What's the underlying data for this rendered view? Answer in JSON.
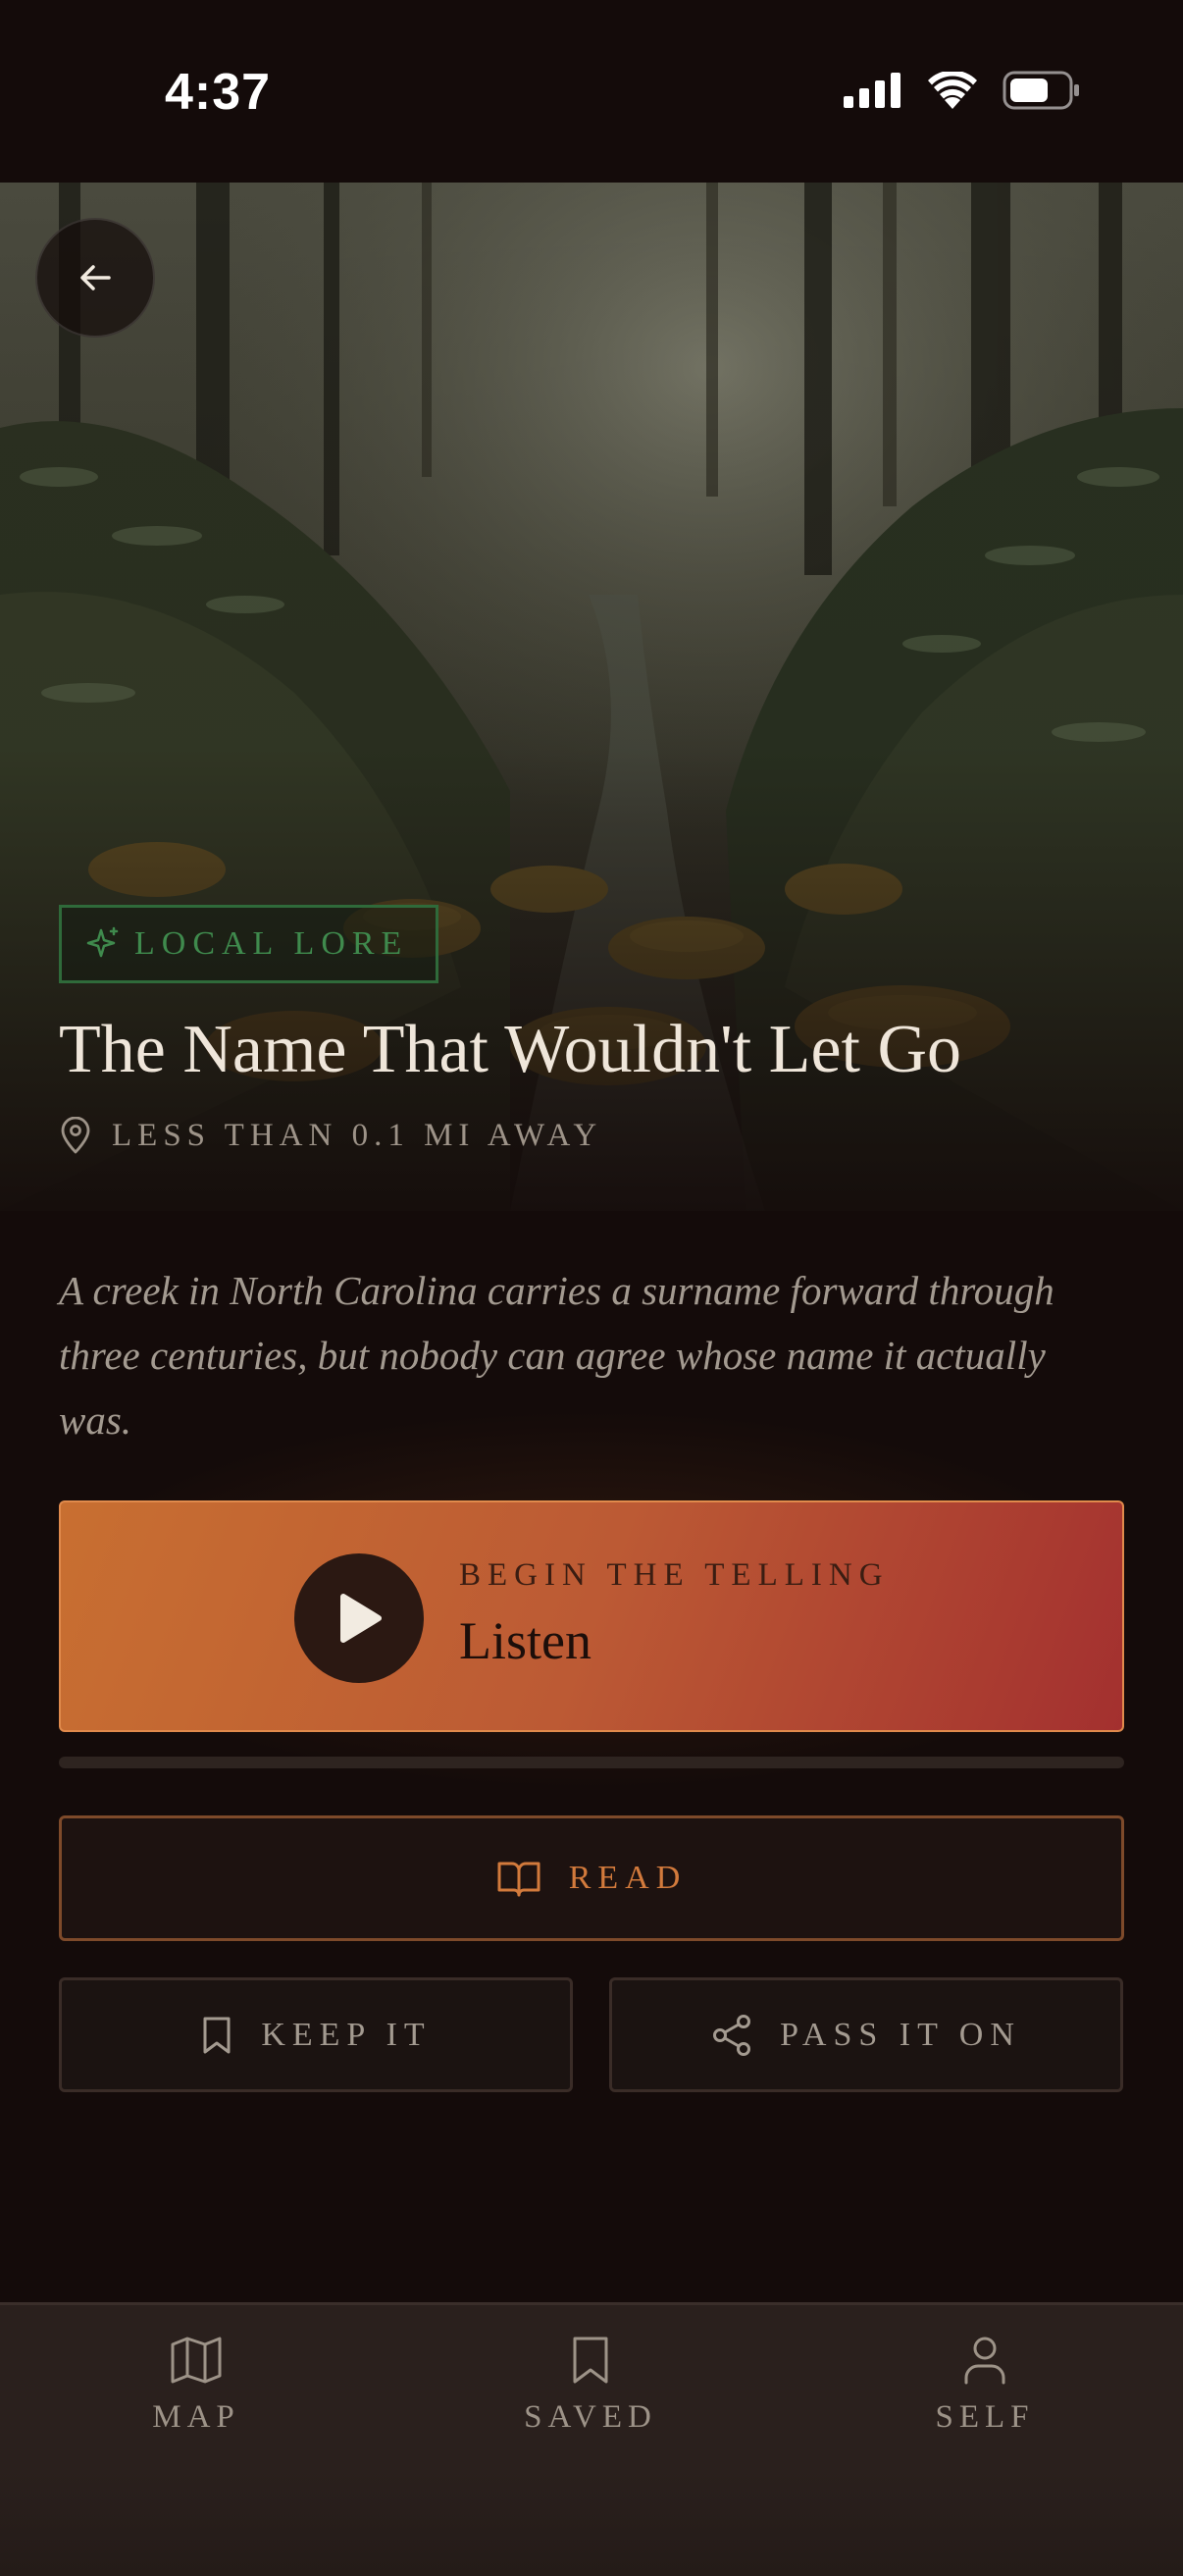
{
  "status_bar": {
    "time": "4:37"
  },
  "hero": {
    "badge": "LOCAL LORE",
    "title": "The Name That Wouldn't Let Go",
    "distance": "LESS THAN 0.1 MI AWAY",
    "icons": {
      "back": "arrow-left-icon",
      "badge": "sparkle-icon",
      "distance": "map-pin-icon"
    }
  },
  "story": {
    "description": "A creek in North Carolina carries a surname forward through three centuries, but nobody can agree whose name it actually was."
  },
  "listen_button": {
    "kicker": "BEGIN THE TELLING",
    "label": "Listen",
    "icon": "play-icon"
  },
  "playback": {
    "progress": 0
  },
  "actions": {
    "read": {
      "label": "READ",
      "icon": "book-open-icon"
    },
    "keep": {
      "label": "KEEP IT",
      "icon": "bookmark-icon"
    },
    "pass": {
      "label": "PASS IT ON",
      "icon": "share-icon"
    }
  },
  "tab_bar": {
    "items": [
      {
        "label": "MAP",
        "icon": "map-icon"
      },
      {
        "label": "SAVED",
        "icon": "bookmark-icon"
      },
      {
        "label": "SELF",
        "icon": "user-icon"
      }
    ]
  },
  "colors": {
    "accent": "#c86f31",
    "accent_end": "#a3302f",
    "lore_green": "#3f8a4d",
    "background": "#140b0a"
  }
}
